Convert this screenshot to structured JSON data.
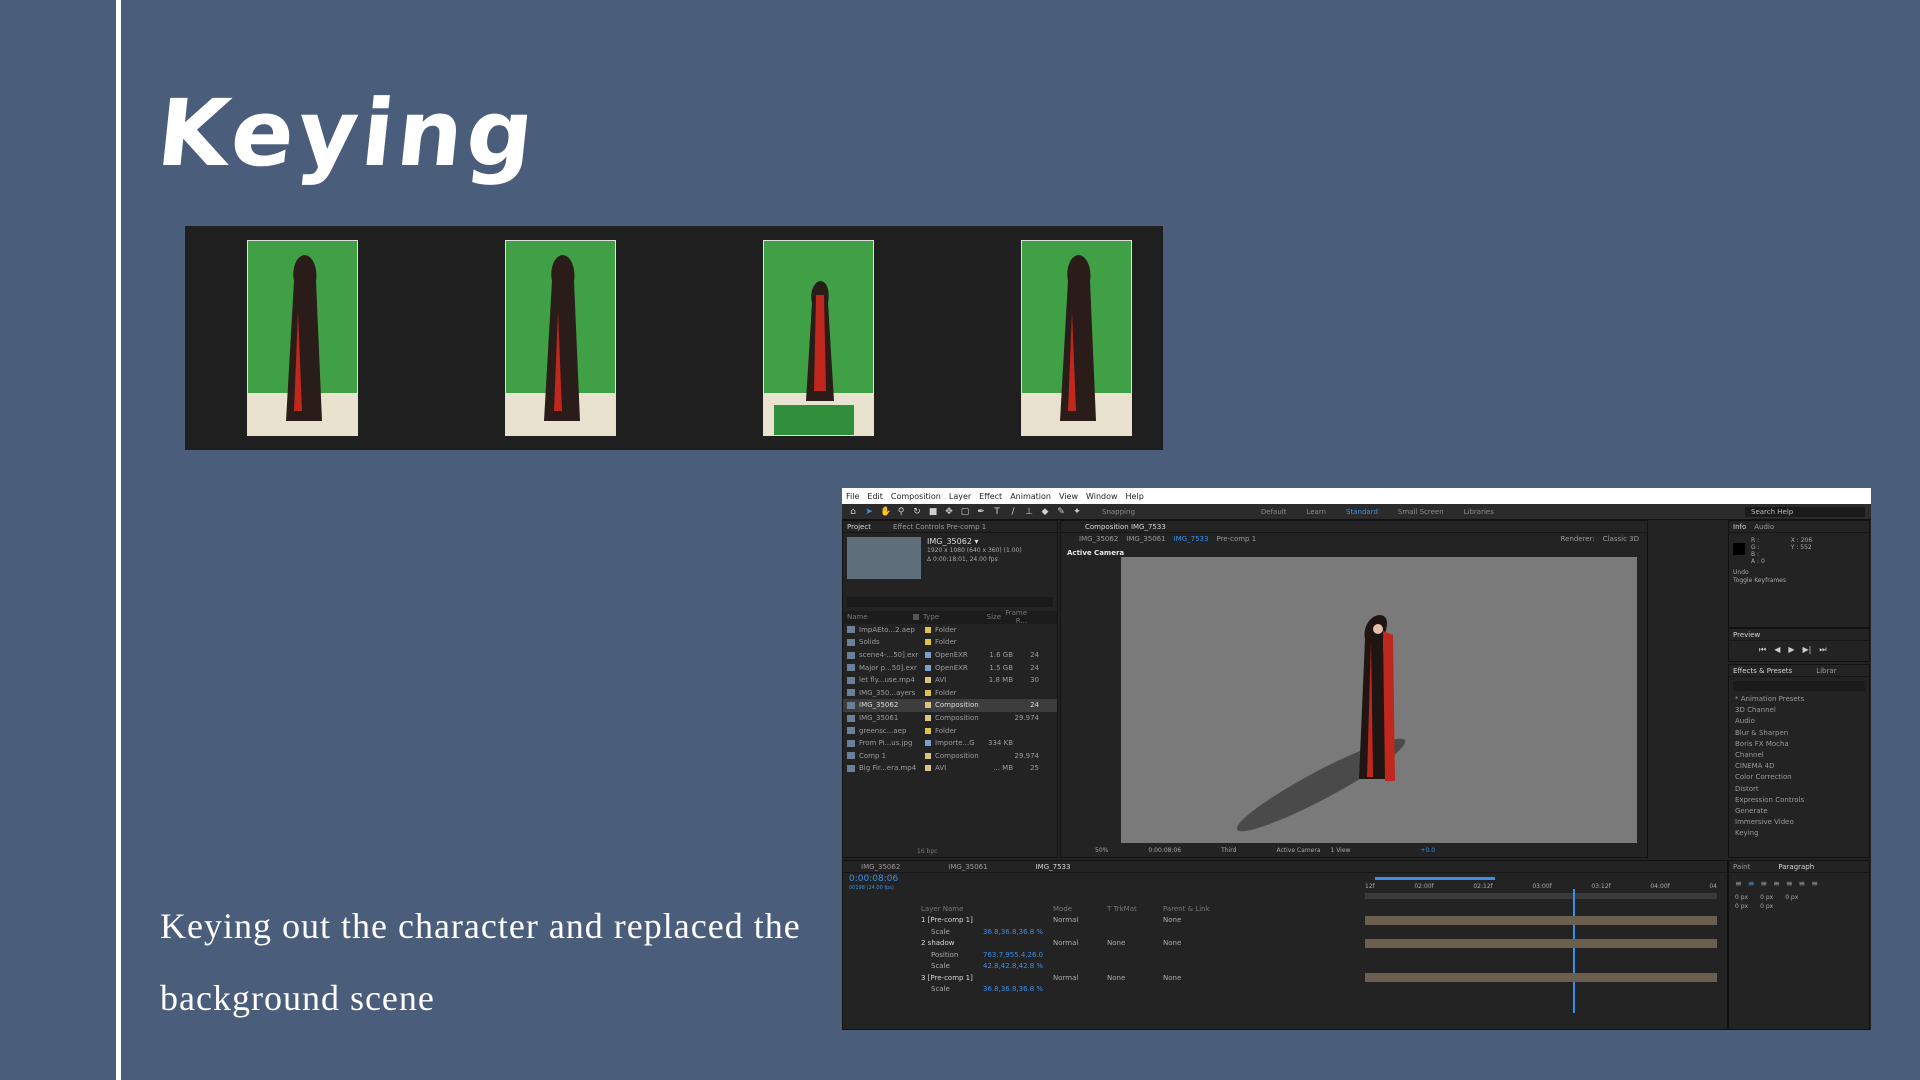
{
  "slide": {
    "title": "Keying",
    "caption": "Keying out the character and replaced the background scene"
  },
  "colors": {
    "background": "#4a5d7a",
    "strip": "#1f1f1f",
    "green_screen": "#3fa046",
    "cloak": "#2a1c18",
    "cloak_lining": "#c0281e",
    "accent_blue": "#3c8ee6"
  },
  "frames": [
    {
      "name": "frame-1"
    },
    {
      "name": "frame-2"
    },
    {
      "name": "frame-3"
    },
    {
      "name": "frame-4"
    }
  ],
  "ae": {
    "menu": [
      "File",
      "Edit",
      "Composition",
      "Layer",
      "Effect",
      "Animation",
      "View",
      "Window",
      "Help"
    ],
    "tool_icons": [
      "home-icon",
      "selection-icon",
      "hand-icon",
      "zoom-icon",
      "rotate-icon",
      "camera-icon",
      "pan-icon",
      "rect-mask-icon",
      "pen-icon",
      "type-icon",
      "brush-icon",
      "clone-icon",
      "eraser-icon",
      "roto-icon",
      "puppet-icon"
    ],
    "snapping": "Snapping",
    "workspaces": [
      {
        "label": "Default",
        "active": false
      },
      {
        "label": "Learn",
        "active": false
      },
      {
        "label": "Standard",
        "active": true
      },
      {
        "label": "Small Screen",
        "active": false
      },
      {
        "label": "Libraries",
        "active": false
      }
    ],
    "search_help": "Search Help",
    "project_panel": {
      "tab": "Project",
      "tab2": "Effect Controls Pre-comp 1",
      "item_name": "IMG_35062 ▾",
      "item_info1": "1920 x 1080 (640 x 360) (1.00)",
      "item_info2": "Δ 0:00:18:01, 24.00 fps",
      "col_name": "Name",
      "col_type": "Type",
      "col_size": "Size",
      "col_frame": "Frame R...",
      "rows": [
        {
          "name": "ImpAEto...2.aep",
          "type": "Folder",
          "size": "",
          "fr": "",
          "color": "#e0c14a",
          "sel": false
        },
        {
          "name": "Solids",
          "type": "Folder",
          "size": "",
          "fr": "",
          "color": "#e0c14a",
          "sel": false
        },
        {
          "name": "scene4-...50].exr",
          "type": "OpenEXR",
          "size": "1.6 GB",
          "fr": "24",
          "color": "#7aa0c9",
          "sel": false
        },
        {
          "name": "Major p...50].exr",
          "type": "OpenEXR",
          "size": "1.5 GB",
          "fr": "24",
          "color": "#7aa0c9",
          "sel": false
        },
        {
          "name": "let fly...use.mp4",
          "type": "AVI",
          "size": "1.8 MB",
          "fr": "30",
          "color": "#d9c487",
          "sel": false
        },
        {
          "name": "IMG_350...ayers",
          "type": "Folder",
          "size": "",
          "fr": "",
          "color": "#e0c14a",
          "sel": false
        },
        {
          "name": "IMG_35062",
          "type": "Composition",
          "size": "",
          "fr": "24",
          "color": "#d9c487",
          "sel": true
        },
        {
          "name": "IMG_35061",
          "type": "Composition",
          "size": "",
          "fr": "29.974",
          "color": "#d9c487",
          "sel": false
        },
        {
          "name": "greensc...aep",
          "type": "Folder",
          "size": "",
          "fr": "",
          "color": "#e0c14a",
          "sel": false
        },
        {
          "name": "From Pi...us.jpg",
          "type": "Importe...G",
          "size": "334 KB",
          "fr": "",
          "color": "#7aa0c9",
          "sel": false
        },
        {
          "name": "Comp 1",
          "type": "Composition",
          "size": "",
          "fr": "29.974",
          "color": "#d9c487",
          "sel": false
        },
        {
          "name": "Big Fir...era.mp4",
          "type": "AVI",
          "size": "... MB",
          "fr": "25",
          "color": "#d9c487",
          "sel": false
        }
      ],
      "bpc": "16 bpc"
    },
    "comp_panel": {
      "tab": "Composition IMG_7533",
      "crumbs": [
        "IMG_35062",
        "IMG_35061",
        "IMG_7533",
        "Pre-comp 1"
      ],
      "renderer": "Renderer:",
      "renderer_value": "Classic 3D",
      "active_camera": "Active Camera",
      "zoom": "50%",
      "timecode": "0:00:08:06",
      "resolution": "Third",
      "camera_select": "Active Camera",
      "view_select": "1 View",
      "exposure": "+0.0"
    },
    "info_panel": {
      "tab": "Info",
      "tab2": "Audio",
      "r": "R :",
      "g": "G :",
      "b": "B :",
      "a": "A : 0",
      "x": "X : 206",
      "y": "Y : 552",
      "undo": "Undo",
      "undo_action": "Toggle Keyframes",
      "preview": "Preview"
    },
    "effects_panel": {
      "tab": "Effects & Presets",
      "tab2": "Librar",
      "items": [
        "* Animation Presets",
        "3D Channel",
        "Audio",
        "Blur & Sharpen",
        "Boris FX Mocha",
        "Channel",
        "CINEMA 4D",
        "Color Correction",
        "Distort",
        "Expression Controls",
        "Generate",
        "Immersive Video",
        "Keying"
      ]
    },
    "paragraph_panel": {
      "tab": "Paint",
      "tab2": "Paragraph",
      "px1": "0 px",
      "px2": "0 px",
      "px3": "0 px",
      "px4": "0 px",
      "px5": "0 px"
    },
    "timeline": {
      "tabs": [
        "IMG_35062",
        "IMG_35061",
        "IMG_7533"
      ],
      "timecode": "0:00:08:06",
      "frames": "00198 (24.00 fps)",
      "col_layer": "Layer Name",
      "col_mode": "Mode",
      "col_trkmat": "T  TrkMat",
      "col_parent": "Parent & Link",
      "ruler": [
        "12f",
        "02:00f",
        "02:12f",
        "03:00f",
        "03:12f",
        "04:00f",
        "04"
      ],
      "layers": [
        {
          "label": "1  [Pre-comp 1]",
          "val": "",
          "mode": "Normal",
          "trk": "",
          "parent": "None"
        },
        {
          "label": "Scale",
          "val": "36.8,36.8,36.8 %",
          "mode": "",
          "trk": "",
          "parent": ""
        },
        {
          "label": "2  shadow",
          "val": "",
          "mode": "Normal",
          "trk": "None",
          "parent": "None"
        },
        {
          "label": "Position",
          "val": "763.7,955.4,26.0",
          "mode": "",
          "trk": "",
          "parent": ""
        },
        {
          "label": "Scale",
          "val": "42.8,42.8,42.8 %",
          "mode": "",
          "trk": "",
          "parent": ""
        },
        {
          "label": "3  [Pre-comp 1]",
          "val": "",
          "mode": "Normal",
          "trk": "None",
          "parent": "None"
        },
        {
          "label": "Scale",
          "val": "36.8,36.8,36.8 %",
          "mode": "",
          "trk": "",
          "parent": ""
        }
      ]
    }
  }
}
